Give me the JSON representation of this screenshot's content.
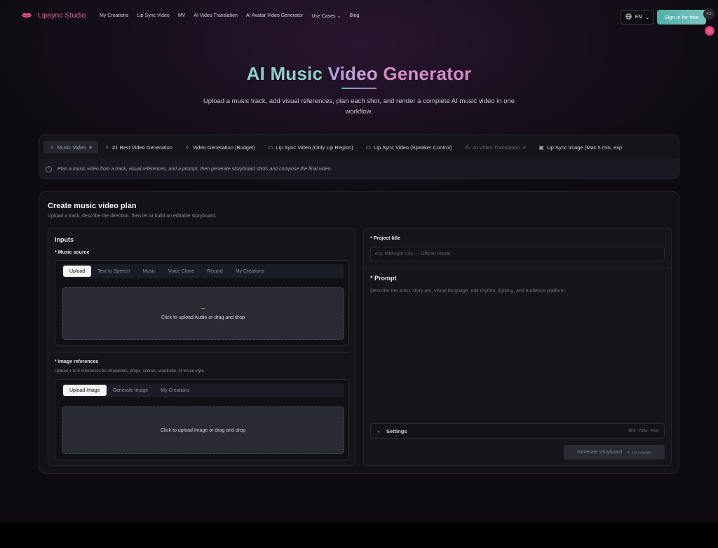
{
  "nav": {
    "brand": "Lipsync Studio",
    "links": [
      "My Creations",
      "Lip Sync Video",
      "MV",
      "AI Video Translation",
      "AI Avatar Video Generator",
      "Use Cases",
      "Blog"
    ],
    "lang": "EN",
    "signin": "Sign in for free",
    "widget_text": "4:5"
  },
  "hero": {
    "title_part1": "AI Music ",
    "title_part2": "Video ",
    "title_part3": "Generator",
    "subtitle": "Upload a music track, add visual references, plan each shot, and render a complete AI music video in one workflow."
  },
  "tools": {
    "tabs": [
      {
        "label": "Music Video",
        "icon": "sparkle-icon",
        "lock": "🔒"
      },
      {
        "label": "#1 Best Video Generation",
        "icon": "sparkle-icon"
      },
      {
        "label": "Video Generation (Budget)",
        "icon": "sparkle-icon"
      },
      {
        "label": "Lip Sync Video (Only Lip Region)",
        "icon": "video-icon"
      },
      {
        "label": "Lip Sync Video (Speaker Control)",
        "icon": "video-icon"
      },
      {
        "label": "AI Video Translation",
        "icon": "translate-icon",
        "lock": "🔒"
      },
      {
        "label": "Lip Sync Image (Max 5 min, exp",
        "icon": "image-icon"
      }
    ],
    "description": "Plan a music video from a track, visual references, and a prompt, then generate storyboard shots and compose the final video."
  },
  "main": {
    "title": "Create music video plan",
    "subtitle": "Upload a track, describe the direction, then let AI build an editable storyboard.",
    "inputs_title": "Inputs",
    "music_source": {
      "label": "Music source",
      "options": [
        "Upload",
        "Text to Speech",
        "Music",
        "Voice Clone",
        "Record",
        "My Creations"
      ],
      "dropzone_dash": "–",
      "dropzone_text": "Click to upload Audio or drag and drop"
    },
    "image_refs": {
      "label": "Image references",
      "hint": "Upload 1 to 5 references for characters, props, scenes, wardrobe, or visual style.",
      "options": [
        "Upload Image",
        "Generate Image",
        "My Creations"
      ],
      "dropzone_text": "Click to upload Image or drag and drop"
    },
    "project_title": {
      "label": "Project title",
      "placeholder": "e.g. Midnight City — Official Visual"
    },
    "prompt": {
      "label": "Prompt",
      "placeholder": "Describe the artist, story arc, visual language, edit rhythm, lighting, and audience platform."
    },
    "settings": {
      "label": "Settings",
      "meta": "16:9 · 720p · Fast"
    },
    "generate": {
      "label": "Generate storyboard",
      "credits": "16 credits"
    }
  }
}
